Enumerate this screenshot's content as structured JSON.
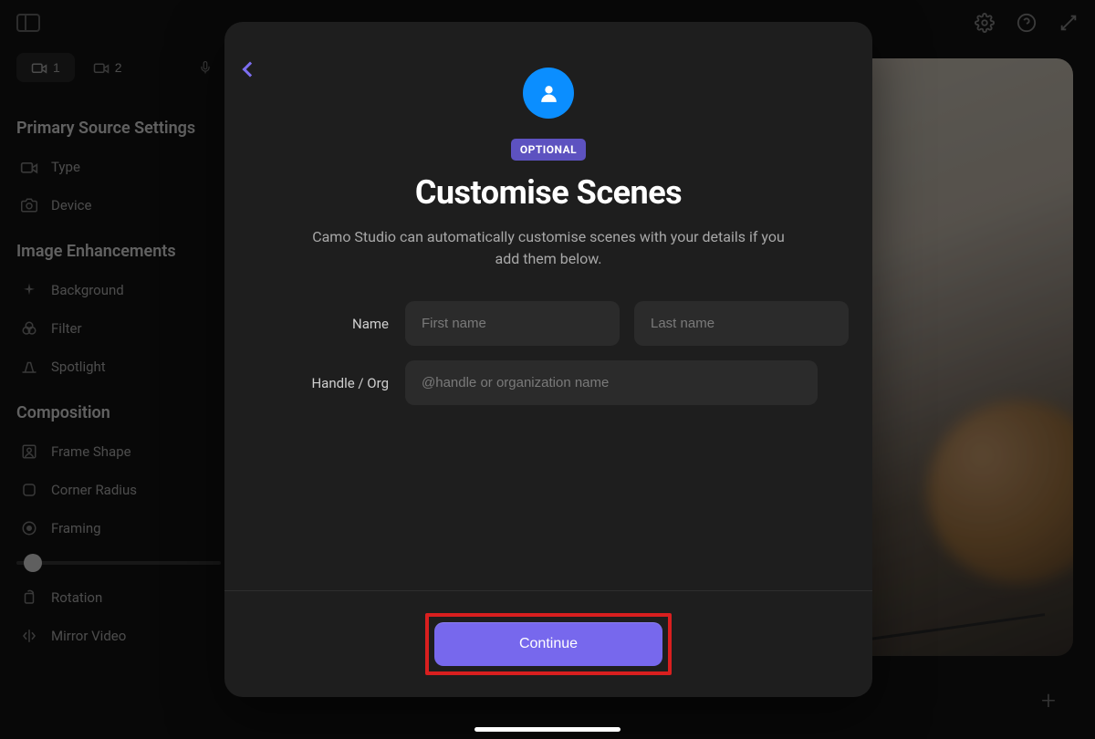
{
  "topbar": {
    "cam1_label": "1",
    "cam2_label": "2"
  },
  "sidebar": {
    "sections": {
      "primary": "Primary Source Settings",
      "enhancements": "Image Enhancements",
      "composition": "Composition"
    },
    "items": {
      "type": "Type",
      "device": "Device",
      "background": "Background",
      "filter": "Filter",
      "spotlight": "Spotlight",
      "frame_shape": "Frame Shape",
      "corner_radius": "Corner Radius",
      "framing": "Framing",
      "rotation": "Rotation",
      "mirror_video": "Mirror Video"
    }
  },
  "modal": {
    "badge": "OPTIONAL",
    "title": "Customise Scenes",
    "description": "Camo Studio can automatically customise scenes with your details if you add them below.",
    "labels": {
      "name": "Name",
      "handle": "Handle / Org"
    },
    "placeholders": {
      "first_name": "First name",
      "last_name": "Last name",
      "handle": "@handle or organization name"
    },
    "continue": "Continue"
  },
  "colors": {
    "accent": "#7768ed",
    "avatar_bg": "#0b8eff",
    "highlight_border": "#d91f1f"
  }
}
